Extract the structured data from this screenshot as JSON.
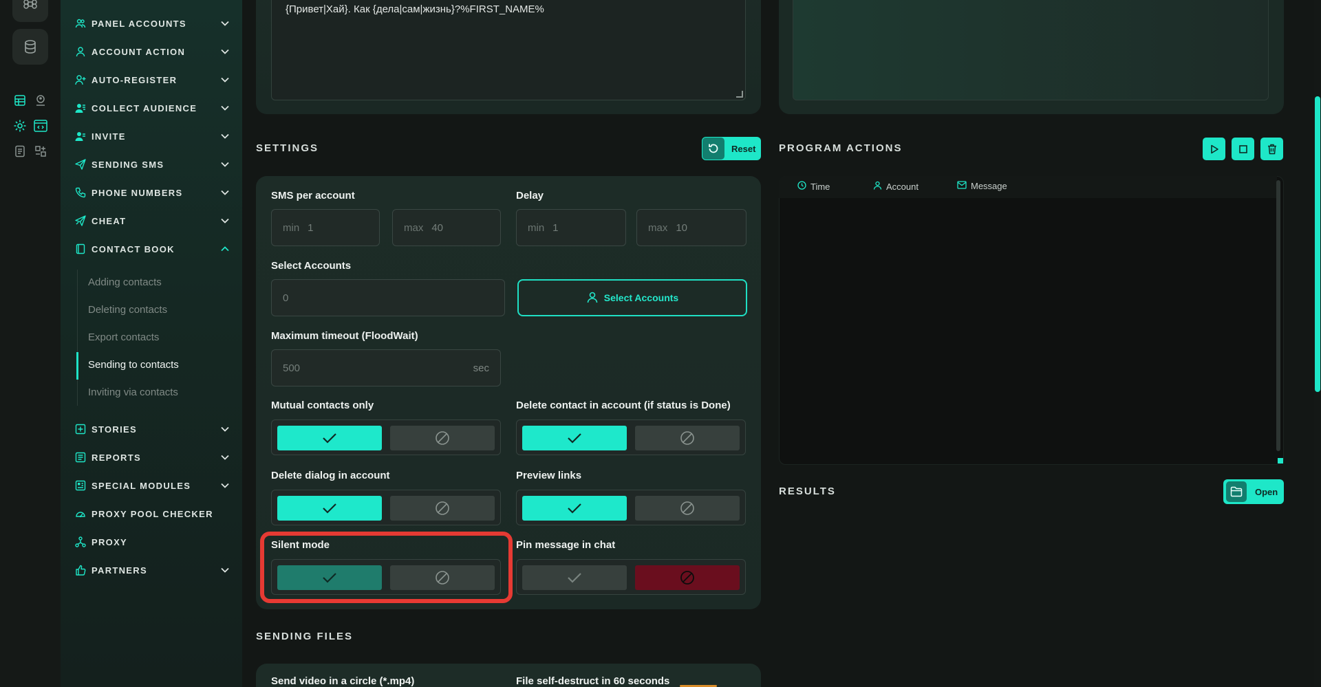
{
  "colors": {
    "accent": "#1ee7c8",
    "accent_dark": "#127e6e",
    "danger": "#6a0e1e",
    "highlight": "#e53a33"
  },
  "rail": {
    "icons": [
      "command-icon",
      "database-icon",
      "table-icon",
      "contacts-icon",
      "settings-icon",
      "code-icon",
      "report-icon",
      "modules-icon"
    ]
  },
  "sidebar": {
    "items": [
      {
        "label": "PANEL ACCOUNTS",
        "icon": "users-icon",
        "expandable": true
      },
      {
        "label": "ACCOUNT ACTION",
        "icon": "user-icon",
        "expandable": true
      },
      {
        "label": "AUTO-REGISTER",
        "icon": "user-plus-icon",
        "expandable": true
      },
      {
        "label": "COLLECT AUDIENCE",
        "icon": "audience-icon",
        "expandable": true
      },
      {
        "label": "INVITE",
        "icon": "invite-icon",
        "expandable": true
      },
      {
        "label": "SENDING SMS",
        "icon": "send-icon",
        "expandable": true
      },
      {
        "label": "PHONE NUMBERS",
        "icon": "phone-icon",
        "expandable": true
      },
      {
        "label": "CHEAT",
        "icon": "cheat-icon",
        "expandable": true
      },
      {
        "label": "CONTACT BOOK",
        "icon": "book-icon",
        "expandable": true,
        "expanded": true
      },
      {
        "label": "STORIES",
        "icon": "stories-icon",
        "expandable": true
      },
      {
        "label": "REPORTS",
        "icon": "reports-icon",
        "expandable": true
      },
      {
        "label": "SPECIAL MODULES",
        "icon": "modules-icon",
        "expandable": true
      },
      {
        "label": "PROXY POOL CHECKER",
        "icon": "proxy-checker-icon",
        "expandable": false
      },
      {
        "label": "PROXY",
        "icon": "proxy-icon",
        "expandable": false
      },
      {
        "label": "PARTNERS",
        "icon": "partners-icon",
        "expandable": true
      }
    ],
    "sub_items": [
      {
        "label": "Adding contacts"
      },
      {
        "label": "Deleting contacts"
      },
      {
        "label": "Export contacts"
      },
      {
        "label": "Sending to contacts",
        "active": true
      },
      {
        "label": "Inviting via contacts"
      }
    ]
  },
  "message": {
    "text": "{Привет|Хай}. Как {дела|сам|жизнь}?%FIRST_NAME%"
  },
  "settings": {
    "title": "SETTINGS",
    "reset_label": "Reset",
    "sms_per_account": {
      "label": "SMS per account",
      "min_ph": "min",
      "min_val": "1",
      "max_ph": "max",
      "max_val": "40"
    },
    "delay": {
      "label": "Delay",
      "min_ph": "min",
      "min_val": "1",
      "max_ph": "max",
      "max_val": "10"
    },
    "select_accounts": {
      "label": "Select Accounts",
      "value": "0",
      "button": "Select Accounts"
    },
    "max_timeout": {
      "label": "Maximum timeout (FloodWait)",
      "value": "500",
      "suffix": "sec"
    },
    "toggles": {
      "mutual": {
        "label": "Mutual contacts only",
        "state": "on"
      },
      "delete_contact": {
        "label": "Delete contact in account (if status is Done)",
        "state": "on"
      },
      "delete_dialog": {
        "label": "Delete dialog in account",
        "state": "on"
      },
      "preview_links": {
        "label": "Preview links",
        "state": "on"
      },
      "silent_mode": {
        "label": "Silent mode",
        "state": "on"
      },
      "pin_message": {
        "label": "Pin message in chat",
        "state": "off"
      }
    }
  },
  "program_actions": {
    "title": "PROGRAM ACTIONS",
    "columns": [
      "Time",
      "Account",
      "Message"
    ]
  },
  "results": {
    "title": "RESULTS",
    "open_label": "Open"
  },
  "sending_files": {
    "title": "SENDING FILES",
    "video_label": "Send video in a circle (*.mp4)",
    "self_destruct_label": "File self-destruct in 60 seconds"
  }
}
